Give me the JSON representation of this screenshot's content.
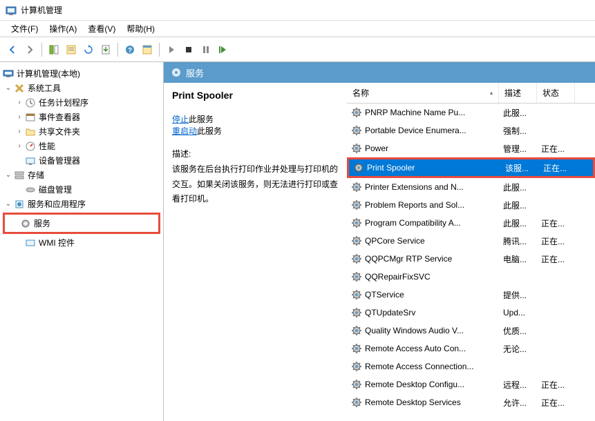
{
  "window": {
    "title": "计算机管理"
  },
  "menubar": {
    "file": "文件(F)",
    "action": "操作(A)",
    "view": "查看(V)",
    "help": "帮助(H)"
  },
  "tree": {
    "root": "计算机管理(本地)",
    "system_tools": "系统工具",
    "task_scheduler": "任务计划程序",
    "event_viewer": "事件查看器",
    "shared_folders": "共享文件夹",
    "performance": "性能",
    "device_manager": "设备管理器",
    "storage": "存储",
    "disk_management": "磁盘管理",
    "services_apps": "服务和应用程序",
    "services": "服务",
    "wmi_control": "WMI 控件"
  },
  "content": {
    "header": "服务",
    "detail_title": "Print Spooler",
    "stop_text": "停止",
    "stop_suffix": "此服务",
    "restart_text": "重启动",
    "restart_suffix": "此服务",
    "desc_label": "描述:",
    "desc_text": "该服务在后台执行打印作业并处理与打印机的交互。如果关闭该服务，则无法进行打印或查看打印机。"
  },
  "list_header": {
    "name": "名称",
    "desc": "描述",
    "status": "状态"
  },
  "services": [
    {
      "name": "PNRP Machine Name Pu...",
      "desc": "此服...",
      "status": ""
    },
    {
      "name": "Portable Device Enumera...",
      "desc": "强制...",
      "status": ""
    },
    {
      "name": "Power",
      "desc": "管理...",
      "status": "正在..."
    },
    {
      "name": "Print Spooler",
      "desc": "该服...",
      "status": "正在...",
      "selected": true
    },
    {
      "name": "Printer Extensions and N...",
      "desc": "此服...",
      "status": ""
    },
    {
      "name": "Problem Reports and Sol...",
      "desc": "此服...",
      "status": ""
    },
    {
      "name": "Program Compatibility A...",
      "desc": "此服...",
      "status": "正在..."
    },
    {
      "name": "QPCore Service",
      "desc": "腾讯...",
      "status": "正在..."
    },
    {
      "name": "QQPCMgr RTP Service",
      "desc": "电脑...",
      "status": "正在..."
    },
    {
      "name": "QQRepairFixSVC",
      "desc": "",
      "status": ""
    },
    {
      "name": "QTService",
      "desc": "提供...",
      "status": ""
    },
    {
      "name": "QTUpdateSrv",
      "desc": "Upd...",
      "status": ""
    },
    {
      "name": "Quality Windows Audio V...",
      "desc": "优质...",
      "status": ""
    },
    {
      "name": "Remote Access Auto Con...",
      "desc": "无论...",
      "status": ""
    },
    {
      "name": "Remote Access Connection...",
      "desc": "",
      "status": ""
    },
    {
      "name": "Remote Desktop Configu...",
      "desc": "远程...",
      "status": "正在..."
    },
    {
      "name": "Remote Desktop Services",
      "desc": "允许...",
      "status": "正在..."
    }
  ]
}
